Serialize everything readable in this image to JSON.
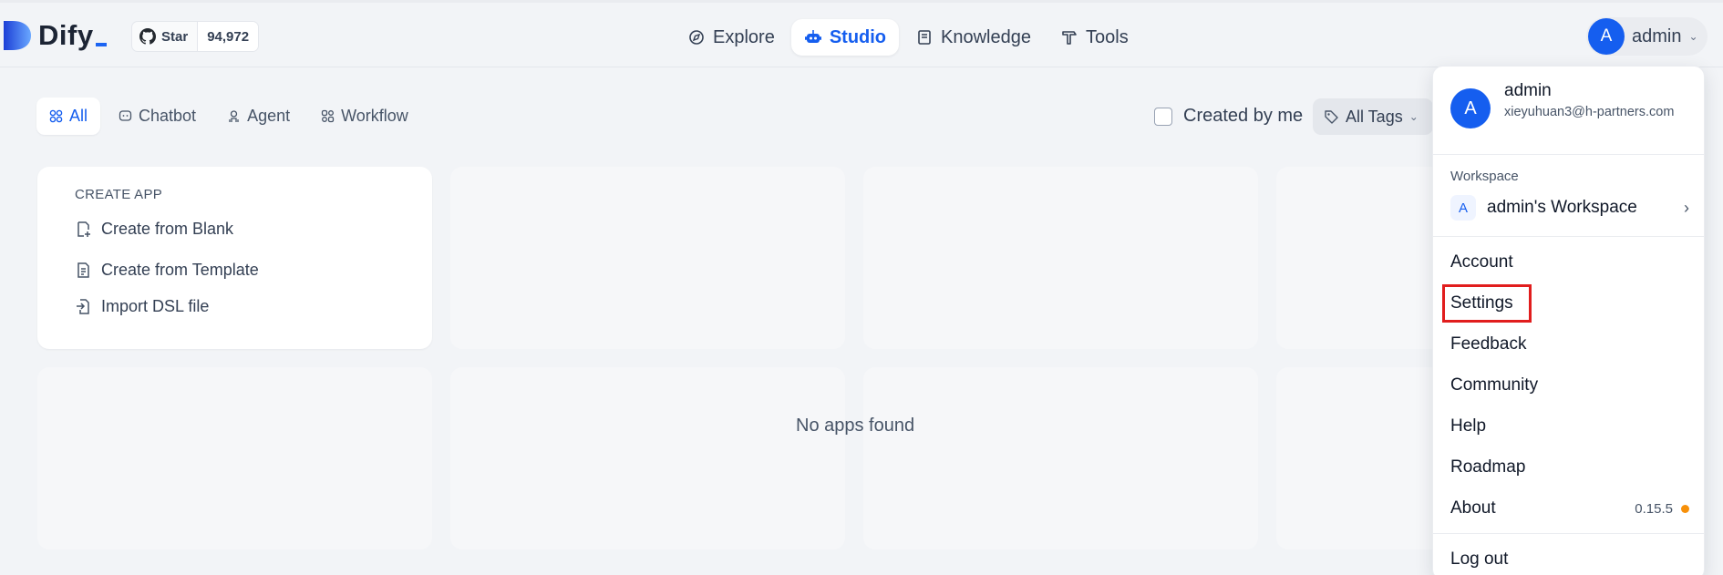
{
  "brand": {
    "name": "Dify"
  },
  "github": {
    "label": "Star",
    "count": "94,972"
  },
  "nav": {
    "items": [
      {
        "label": "Explore",
        "icon": "compass-icon",
        "active": false
      },
      {
        "label": "Studio",
        "icon": "robot-icon",
        "active": true
      },
      {
        "label": "Knowledge",
        "icon": "book-icon",
        "active": false
      },
      {
        "label": "Tools",
        "icon": "hammer-icon",
        "active": false
      }
    ]
  },
  "user": {
    "initial": "A",
    "name": "admin"
  },
  "filters": {
    "items": [
      {
        "label": "All",
        "active": true
      },
      {
        "label": "Chatbot",
        "active": false
      },
      {
        "label": "Agent",
        "active": false
      },
      {
        "label": "Workflow",
        "active": false
      }
    ],
    "created_by_me": "Created by me",
    "tags": "All Tags"
  },
  "create_app": {
    "title": "CREATE APP",
    "items": [
      "Create from Blank",
      "Create from Template",
      "Import DSL file"
    ]
  },
  "empty_message": "No apps found",
  "menu": {
    "name": "admin",
    "email": "xieyuhuan3@h-partners.com",
    "initial": "A",
    "workspace_label": "Workspace",
    "workspace_initial": "A",
    "workspace_name": "admin's Workspace",
    "items": [
      "Account",
      "Settings",
      "Feedback",
      "Community",
      "Help",
      "Roadmap",
      "About"
    ],
    "highlighted": "Settings",
    "version": "0.15.5",
    "logout": "Log out"
  },
  "colors": {
    "accent": "#155eef",
    "highlight": "#e11d1d",
    "status_dot": "#f79009"
  }
}
